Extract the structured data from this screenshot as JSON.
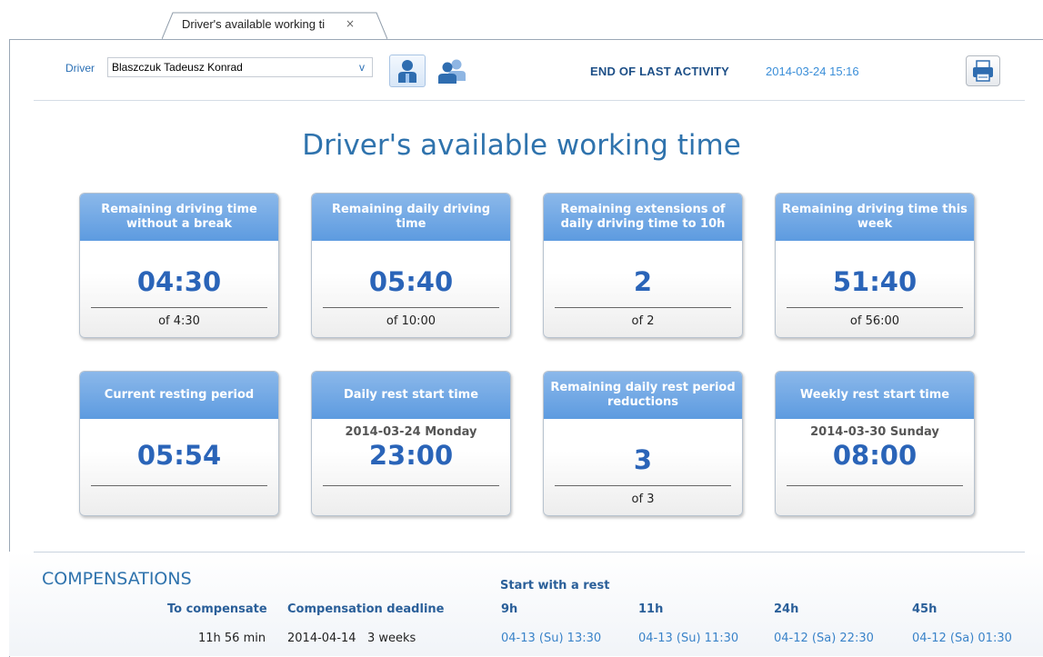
{
  "tab": {
    "label": "Driver's available working ti",
    "close": "×"
  },
  "header": {
    "driver_label": "Driver",
    "driver_value": "Blaszczuk Tadeusz Konrad",
    "dropdown_arrow": "v",
    "last_activity_label": "END OF LAST ACTIVITY",
    "last_activity_value": "2014-03-24 15:16"
  },
  "title": "Driver's available working time",
  "cards": [
    {
      "head": "Remaining driving time without a break",
      "value": "04:30",
      "of": "of 4:30"
    },
    {
      "head": "Remaining daily driving time",
      "value": "05:40",
      "of": "of 10:00"
    },
    {
      "head": "Remaining extensions of daily driving time to 10h",
      "value": "2",
      "of": "of 2"
    },
    {
      "head": "Remaining driving time this week",
      "value": "51:40",
      "of": "of 56:00"
    },
    {
      "head": "Current resting period",
      "value": "05:54"
    },
    {
      "head": "Daily rest start time",
      "sub": "2014-03-24 Monday",
      "value": "23:00"
    },
    {
      "head": "Remaining daily rest period reductions",
      "value": "3",
      "of": "of 3"
    },
    {
      "head": "Weekly rest start time",
      "sub": "2014-03-30 Sunday",
      "value": "08:00"
    }
  ],
  "compensations": {
    "title": "COMPENSATIONS",
    "to_compensate_h": "To compensate",
    "deadline_h": "Compensation deadline",
    "start_rest_h": "Start with a rest",
    "cols": [
      "9h",
      "11h",
      "24h",
      "45h"
    ],
    "to_compensate": "11h 56 min",
    "deadline_date": "2014-04-14",
    "deadline_weeks": "3 weeks",
    "values": [
      "04-13 (Su) 13:30",
      "04-13 (Su) 11:30",
      "04-12 (Sa) 22:30",
      "04-12 (Sa) 01:30"
    ]
  },
  "colors": {
    "accent": "#2f73ad",
    "card_header": "#5d9be0",
    "value": "#2a64b8"
  },
  "icons": {
    "single_driver": "single-driver-icon",
    "crew": "crew-icon",
    "print": "printer-icon"
  }
}
